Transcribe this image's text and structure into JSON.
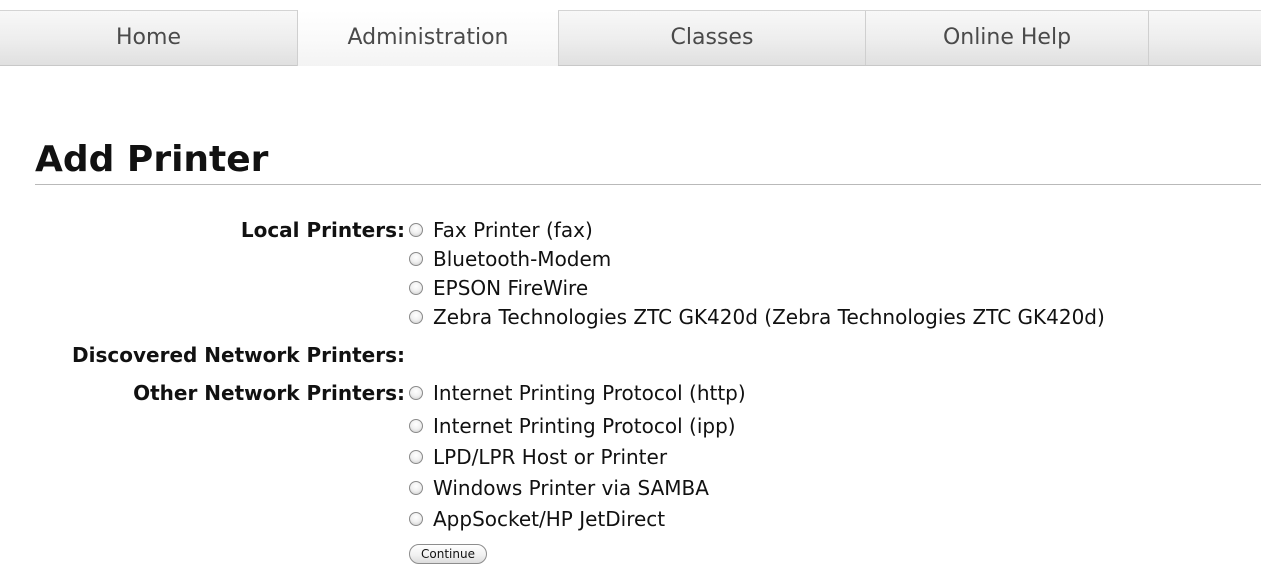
{
  "nav": {
    "tabs": [
      {
        "label": "Home"
      },
      {
        "label": "Administration",
        "active": true
      },
      {
        "label": "Classes"
      },
      {
        "label": "Online Help"
      }
    ]
  },
  "page": {
    "title": "Add Printer"
  },
  "form": {
    "groups": [
      {
        "label": "Local Printers:",
        "options": [
          "Fax Printer (fax)",
          "Bluetooth-Modem",
          "EPSON FireWire",
          "Zebra Technologies ZTC GK420d (Zebra Technologies ZTC GK420d)"
        ]
      },
      {
        "label": "Discovered Network Printers:",
        "options": []
      },
      {
        "label": "Other Network Printers:",
        "options": [
          "Internet Printing Protocol (http)",
          "Internet Printing Protocol (ipp)",
          "LPD/LPR Host or Printer",
          "Windows Printer via SAMBA",
          "AppSocket/HP JetDirect"
        ]
      }
    ],
    "continue_label": "Continue"
  },
  "icons": {
    "radio": "radio-button-icon"
  }
}
